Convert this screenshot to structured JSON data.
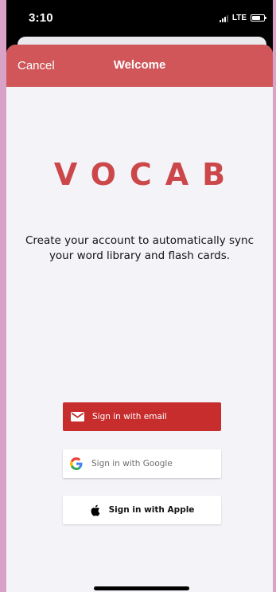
{
  "status_bar": {
    "time": "3:10",
    "network": "LTE",
    "battery_level": 0.7,
    "icons": [
      "signal-icon",
      "battery-icon"
    ]
  },
  "nav": {
    "cancel_label": "Cancel",
    "title": "Welcome"
  },
  "brand": {
    "logo_text": "VOCAB",
    "accent_color": "#cc474a"
  },
  "content": {
    "tagline": "Create your account to automatically sync your word library and flash cards."
  },
  "auth_buttons": {
    "email": {
      "label": "Sign in with email",
      "icon": "mail-icon",
      "color": "#c72d2d"
    },
    "google": {
      "label": "Sign in with Google",
      "icon": "google-icon",
      "color": "#ffffff"
    },
    "apple": {
      "label": "Sign in with Apple",
      "icon": "apple-icon",
      "color": "#ffffff"
    }
  }
}
